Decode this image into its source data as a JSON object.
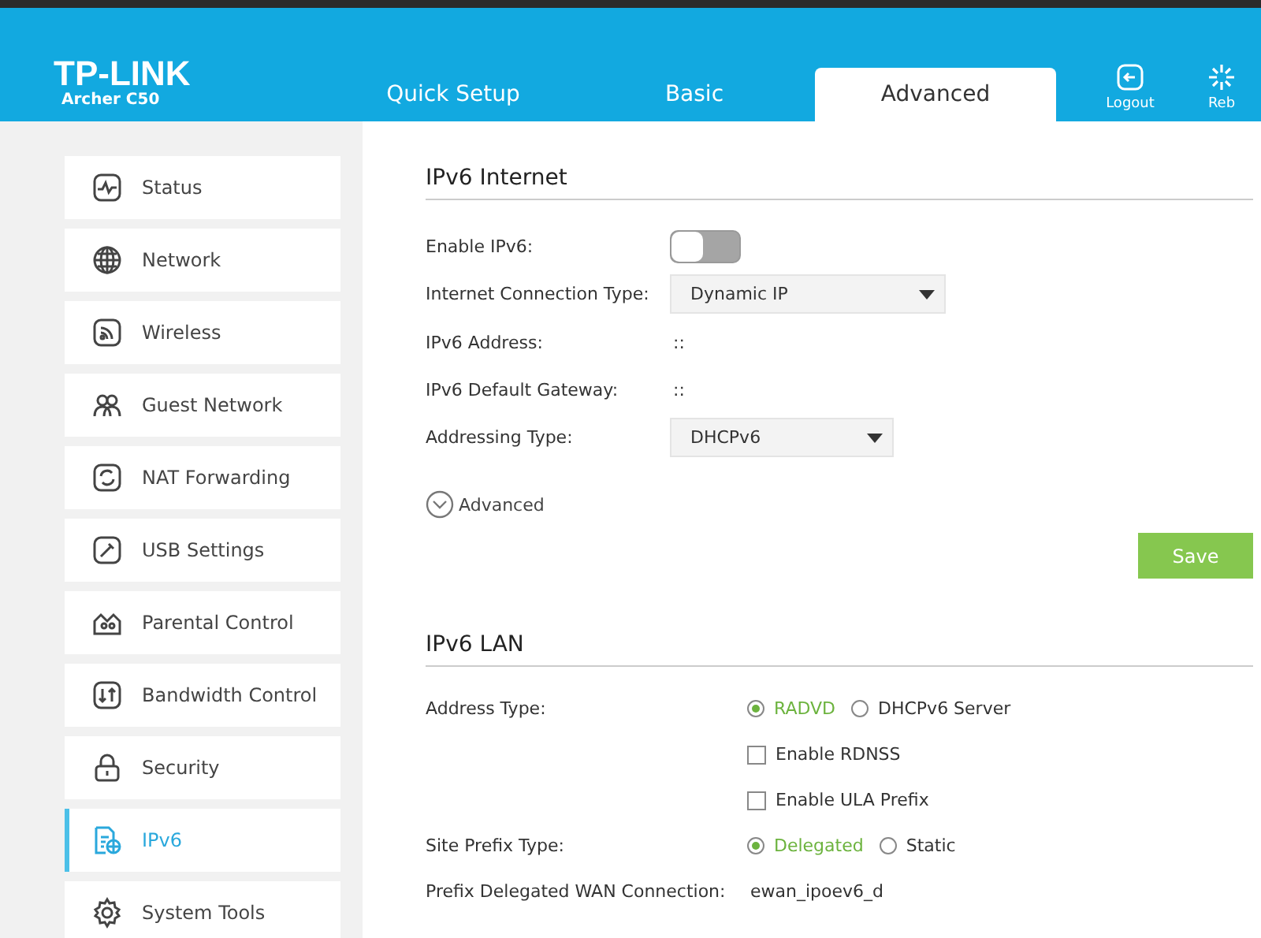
{
  "header": {
    "logo": "TP-LINK",
    "model": "Archer C50",
    "tabs": [
      {
        "label": "Quick Setup",
        "selected": false
      },
      {
        "label": "Basic",
        "selected": false
      },
      {
        "label": "Advanced",
        "selected": true
      }
    ],
    "actions": [
      {
        "label": "Logout"
      },
      {
        "label": "Reb"
      }
    ]
  },
  "sidebar": {
    "items": [
      {
        "label": "Status",
        "selected": false
      },
      {
        "label": "Network",
        "selected": false
      },
      {
        "label": "Wireless",
        "selected": false
      },
      {
        "label": "Guest Network",
        "selected": false
      },
      {
        "label": "NAT Forwarding",
        "selected": false
      },
      {
        "label": "USB Settings",
        "selected": false
      },
      {
        "label": "Parental Control",
        "selected": false
      },
      {
        "label": "Bandwidth Control",
        "selected": false
      },
      {
        "label": "Security",
        "selected": false
      },
      {
        "label": "IPv6",
        "selected": true
      },
      {
        "label": "System Tools",
        "selected": false
      }
    ]
  },
  "ipv6_internet": {
    "title": "IPv6 Internet",
    "rows": [
      {
        "kind": "toggle",
        "label": "Enable IPv6:",
        "on": false
      },
      {
        "kind": "select",
        "label": "Internet Connection Type:",
        "value": "Dynamic IP"
      },
      {
        "kind": "text",
        "label": "IPv6 Address:",
        "value": "::"
      },
      {
        "kind": "text",
        "label": "IPv6 Default Gateway:",
        "value": "::"
      },
      {
        "kind": "select",
        "label": "Addressing Type:",
        "value": "DHCPv6"
      }
    ],
    "advanced_link": {
      "label": "Advanced",
      "expanded": false
    },
    "save_button": "Save"
  },
  "ipv6_lan": {
    "title": "IPv6 LAN",
    "rows": [
      {
        "kind": "radio",
        "label": "Address Type:",
        "options": [
          {
            "label": "RADVD",
            "selected": true
          },
          {
            "label": "DHCPv6 Server",
            "selected": false
          }
        ]
      },
      {
        "kind": "checkbox",
        "text": "Enable RDNSS",
        "checked": false
      },
      {
        "kind": "checkbox",
        "text": "Enable ULA Prefix",
        "checked": false
      },
      {
        "kind": "radio",
        "label": "Site Prefix Type:",
        "options": [
          {
            "label": "Delegated",
            "selected": true
          },
          {
            "label": "Static",
            "selected": false
          }
        ]
      },
      {
        "kind": "text",
        "label": "Prefix Delegated WAN Connection:",
        "value": "ewan_ipoev6_d"
      }
    ]
  }
}
